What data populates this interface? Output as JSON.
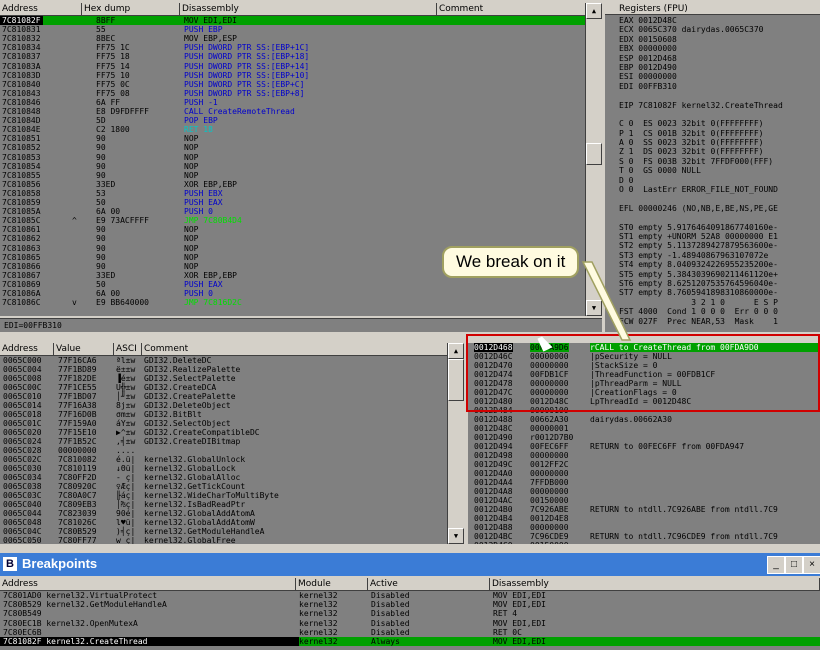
{
  "disasm": {
    "headers": [
      "Address",
      "Hex dump",
      "Disassembly",
      "Comment"
    ],
    "rows": [
      {
        "addr": "7C81082F",
        "mark": "",
        "hex": "8BFF",
        "dis": "MOV EDI,EDI",
        "cls": "",
        "sel": true
      },
      {
        "addr": "7C810831",
        "mark": "",
        "hex": "55",
        "dis": "PUSH EBP",
        "cls": "blue"
      },
      {
        "addr": "7C810832",
        "mark": "",
        "hex": "8BEC",
        "dis": "MOV EBP,ESP",
        "cls": ""
      },
      {
        "addr": "7C810834",
        "mark": "",
        "hex": "FF75 1C",
        "dis": "PUSH DWORD PTR SS:[EBP+1C]",
        "cls": "blue"
      },
      {
        "addr": "7C810837",
        "mark": "",
        "hex": "FF75 18",
        "dis": "PUSH DWORD PTR SS:[EBP+18]",
        "cls": "blue"
      },
      {
        "addr": "7C81083A",
        "mark": "",
        "hex": "FF75 14",
        "dis": "PUSH DWORD PTR SS:[EBP+14]",
        "cls": "blue"
      },
      {
        "addr": "7C81083D",
        "mark": "",
        "hex": "FF75 10",
        "dis": "PUSH DWORD PTR SS:[EBP+10]",
        "cls": "blue"
      },
      {
        "addr": "7C810840",
        "mark": "",
        "hex": "FF75 0C",
        "dis": "PUSH DWORD PTR SS:[EBP+C]",
        "cls": "blue"
      },
      {
        "addr": "7C810843",
        "mark": "",
        "hex": "FF75 08",
        "dis": "PUSH DWORD PTR SS:[EBP+8]",
        "cls": "blue"
      },
      {
        "addr": "7C810846",
        "mark": "",
        "hex": "6A FF",
        "dis": "PUSH -1",
        "cls": "blue"
      },
      {
        "addr": "7C810848",
        "mark": "",
        "hex": "E8 D9FDFFFF",
        "dis": "CALL CreateRemoteThread",
        "cls": "blue"
      },
      {
        "addr": "7C81084D",
        "mark": "",
        "hex": "5D",
        "dis": "POP EBP",
        "cls": "blue"
      },
      {
        "addr": "7C81084E",
        "mark": "",
        "hex": "C2 1800",
        "dis": "RET 18",
        "cls": "cyan"
      },
      {
        "addr": "7C810851",
        "mark": "",
        "hex": "90",
        "dis": "NOP",
        "cls": ""
      },
      {
        "addr": "7C810852",
        "mark": "",
        "hex": "90",
        "dis": "NOP",
        "cls": ""
      },
      {
        "addr": "7C810853",
        "mark": "",
        "hex": "90",
        "dis": "NOP",
        "cls": ""
      },
      {
        "addr": "7C810854",
        "mark": "",
        "hex": "90",
        "dis": "NOP",
        "cls": ""
      },
      {
        "addr": "7C810855",
        "mark": "",
        "hex": "90",
        "dis": "NOP",
        "cls": ""
      },
      {
        "addr": "7C810856",
        "mark": "",
        "hex": "33ED",
        "dis": "XOR EBP,EBP",
        "cls": ""
      },
      {
        "addr": "7C810858",
        "mark": "",
        "hex": "53",
        "dis": "PUSH EBX",
        "cls": "blue"
      },
      {
        "addr": "7C810859",
        "mark": "",
        "hex": "50",
        "dis": "PUSH EAX",
        "cls": "blue"
      },
      {
        "addr": "7C81085A",
        "mark": "",
        "hex": "6A 00",
        "dis": "PUSH 0",
        "cls": "blue"
      },
      {
        "addr": "7C81085C",
        "mark": "^",
        "hex": "E9 73ACFFFF",
        "dis": "JMP 7C80B4D4",
        "cls": "grn"
      },
      {
        "addr": "7C810861",
        "mark": "",
        "hex": "90",
        "dis": "NOP",
        "cls": ""
      },
      {
        "addr": "7C810862",
        "mark": "",
        "hex": "90",
        "dis": "NOP",
        "cls": ""
      },
      {
        "addr": "7C810863",
        "mark": "",
        "hex": "90",
        "dis": "NOP",
        "cls": ""
      },
      {
        "addr": "7C810865",
        "mark": "",
        "hex": "90",
        "dis": "NOP",
        "cls": ""
      },
      {
        "addr": "7C810866",
        "mark": "",
        "hex": "90",
        "dis": "NOP",
        "cls": ""
      },
      {
        "addr": "7C810867",
        "mark": "",
        "hex": "33ED",
        "dis": "XOR EBP,EBP",
        "cls": ""
      },
      {
        "addr": "7C810869",
        "mark": "",
        "hex": "50",
        "dis": "PUSH EAX",
        "cls": "blue"
      },
      {
        "addr": "7C81086A",
        "mark": "",
        "hex": "6A 00",
        "dis": "PUSH 0",
        "cls": "blue"
      },
      {
        "addr": "7C81086C",
        "mark": "v",
        "hex": "E9 BB640000",
        "dis": "JMP 7C816D2C",
        "cls": "grn"
      }
    ],
    "info": "EDI=00FFB310"
  },
  "registers": {
    "title": "Registers (FPU)",
    "lines": [
      "EAX 0012D48C",
      "ECX 0065C370 dairydas.0065C370",
      "EDX 00150608",
      "EBX 00000000",
      "ESP 0012D468",
      "EBP 0012D490",
      "ESI 00000000",
      "EDI 00FFB310",
      "",
      "EIP 7C81082F kernel32.CreateThread",
      "",
      "C 0  ES 0023 32bit 0(FFFFFFFF)",
      "P 1  CS 001B 32bit 0(FFFFFFFF)",
      "A 0  SS 0023 32bit 0(FFFFFFFF)",
      "Z 1  DS 0023 32bit 0(FFFFFFFF)",
      "S 0  FS 003B 32bit 7FFDF000(FFF)",
      "T 0  GS 0000 NULL",
      "D 0",
      "O 0  LastErr ERROR_FILE_NOT_FOUND",
      "",
      "EFL 00000246 (NO,NB,E,BE,NS,PE,GE",
      "",
      "ST0 empty 5.9176464091867740160e-",
      "ST1 empty +UNORM 52A8 00000000 E1",
      "ST2 empty 5.1137289427879563600e-",
      "ST3 empty -1.48940867963107072e",
      "ST4 empty 8.0409324226955235200e-",
      "ST5 empty 5.3843039690211461120e+",
      "ST6 empty 8.6251207535764596040e-",
      "ST7 empty 8.7605941898310860000e-",
      "               3 2 1 0      E S P",
      "FST 4000  Cond 1 0 0 0  Err 0 0 0",
      "FCW 027F  Prec NEAR,53  Mask    1"
    ]
  },
  "dump": {
    "headers": [
      "Address",
      "Value",
      "ASCI",
      "Comment"
    ],
    "rows": [
      {
        "addr": "0065C000",
        "val": "77F16CA6",
        "asc": "ªl±w",
        "cmt": "GDI32.DeleteDC"
      },
      {
        "addr": "0065C004",
        "val": "77F1BD89",
        "asc": "ë±±w",
        "cmt": "GDI32.RealizePalette"
      },
      {
        "addr": "0065C008",
        "val": "77F182DE",
        "asc": "▐é±w",
        "cmt": "GDI32.SelectPalette"
      },
      {
        "addr": "0065C00C",
        "val": "77F1CE55",
        "asc": "U╬±w",
        "cmt": "GDI32.CreateDCA"
      },
      {
        "addr": "0065C010",
        "val": "77F1BD07",
        "asc": "│╜±w",
        "cmt": "GDI32.CreatePalette"
      },
      {
        "addr": "0065C014",
        "val": "77F16A38",
        "asc": "8j±w",
        "cmt": "GDI32.DeleteObject"
      },
      {
        "addr": "0065C018",
        "val": "77F16D0B",
        "asc": "σm±w",
        "cmt": "GDI32.BitBlt"
      },
      {
        "addr": "0065C01C",
        "val": "77F159A0",
        "asc": "áY±w",
        "cmt": "GDI32.SelectObject"
      },
      {
        "addr": "0065C020",
        "val": "77F15E10",
        "asc": "▶^±w",
        "cmt": "GDI32.CreateCompatibleDC"
      },
      {
        "addr": "0065C024",
        "val": "77F1B52C",
        "asc": ",╡±w",
        "cmt": "GDI32.CreateDIBitmap"
      },
      {
        "addr": "0065C028",
        "val": "00000000",
        "asc": "....",
        "cmt": ""
      },
      {
        "addr": "0065C02C",
        "val": "7C810082",
        "asc": "é.ü|",
        "cmt": "kernel32.GlobalUnlock"
      },
      {
        "addr": "0065C030",
        "val": "7C810119",
        "asc": "↓Θü|",
        "cmt": "kernel32.GlobalLock"
      },
      {
        "addr": "0065C034",
        "val": "7C80FF2D",
        "asc": "- ç|",
        "cmt": "kernel32.GlobalAlloc"
      },
      {
        "addr": "0065C038",
        "val": "7C80920C",
        "asc": "♀Æç|",
        "cmt": "kernel32.GetTickCount"
      },
      {
        "addr": "0065C03C",
        "val": "7C80A0C7",
        "asc": "╟áç|",
        "cmt": "kernel32.WideCharToMultiByte"
      },
      {
        "addr": "0065C040",
        "val": "7C809EB3",
        "asc": "│₧ç|",
        "cmt": "kernel32.IsBadReadPtr"
      },
      {
        "addr": "0065C044",
        "val": "7C823039",
        "asc": "90é|",
        "cmt": "kernel32.GlobalAddAtomA"
      },
      {
        "addr": "0065C048",
        "val": "7C81026C",
        "asc": "l♥ü|",
        "cmt": "kernel32.GlobalAddAtomW"
      },
      {
        "addr": "0065C04C",
        "val": "7C80B529",
        "asc": ")╡ç|",
        "cmt": "kernel32.GetModuleHandleA"
      },
      {
        "addr": "0065C050",
        "val": "7C80FF77",
        "asc": "w ç|",
        "cmt": "kernel32.GlobalFree"
      }
    ]
  },
  "stack": {
    "rows": [
      {
        "addr": "0012D468",
        "val": "00FDA9D6",
        "txt": "rCALL to CreateThread from 00FDA9D0",
        "sel": true
      },
      {
        "addr": "0012D46C",
        "val": "00000000",
        "txt": "|pSecurity = NULL"
      },
      {
        "addr": "0012D470",
        "val": "00000000",
        "txt": "|StackSize = 0"
      },
      {
        "addr": "0012D474",
        "val": "00FDB1CF",
        "txt": "|ThreadFunction = 00FDB1CF"
      },
      {
        "addr": "0012D478",
        "val": "00000000",
        "txt": "|pThreadParm = NULL"
      },
      {
        "addr": "0012D47C",
        "val": "00000000",
        "txt": "|CreationFlags = 0"
      },
      {
        "addr": "0012D480",
        "val": "0012D48C",
        "txt": "LpThreadId = 0012D48C"
      },
      {
        "addr": "0012D484",
        "val": "00000100",
        "txt": ""
      },
      {
        "addr": "0012D488",
        "val": "00662A30",
        "txt": "dairydas.00662A30"
      },
      {
        "addr": "0012D48C",
        "val": "00000001",
        "txt": ""
      },
      {
        "addr": "0012D490",
        "val": "r0012D7B0",
        "txt": ""
      },
      {
        "addr": "0012D494",
        "val": "00FEC6FF",
        "txt": "RETURN to 00FEC6FF from 00FDA947"
      },
      {
        "addr": "0012D498",
        "val": "00000000",
        "txt": ""
      },
      {
        "addr": "0012D49C",
        "val": "0012FF2C",
        "txt": ""
      },
      {
        "addr": "0012D4A0",
        "val": "00000000",
        "txt": ""
      },
      {
        "addr": "0012D4A4",
        "val": "7FFDB000",
        "txt": ""
      },
      {
        "addr": "0012D4A8",
        "val": "00000000",
        "txt": ""
      },
      {
        "addr": "0012D4AC",
        "val": "00150000",
        "txt": ""
      },
      {
        "addr": "0012D4B0",
        "val": "7C926ABE",
        "txt": "RETURN to ntdll.7C926ABE from ntdll.7C9"
      },
      {
        "addr": "0012D4B4",
        "val": "0012D4E8",
        "txt": ""
      },
      {
        "addr": "0012D4B8",
        "val": "00000000",
        "txt": ""
      },
      {
        "addr": "0012D4BC",
        "val": "7C96CDE9",
        "txt": "RETURN to ntdll.7C96CDE9 from ntdll.7C9"
      },
      {
        "addr": "0012D4C0",
        "val": "00150000",
        "txt": ""
      }
    ]
  },
  "callout": "We break on it",
  "breakpoints": {
    "title": "Breakpoints",
    "headers": [
      "Address",
      "Module",
      "Active",
      "Disassembly"
    ],
    "rows": [
      {
        "addr": "7C801AD0 kernel32.VirtualProtect",
        "mod": "kernel32",
        "act": "Disabled",
        "dis": "MOV EDI,EDI"
      },
      {
        "addr": "7C80B529 kernel32.GetModuleHandleA",
        "mod": "kernel32",
        "act": "Disabled",
        "dis": "MOV EDI,EDI"
      },
      {
        "addr": "7C80B549",
        "mod": "kernel32",
        "act": "Disabled",
        "dis": "RET 4"
      },
      {
        "addr": "7C80EC1B kernel32.OpenMutexA",
        "mod": "kernel32",
        "act": "Disabled",
        "dis": "MOV EDI,EDI"
      },
      {
        "addr": "7C80EC6B",
        "mod": "kernel32",
        "act": "Disabled",
        "dis": "RET 0C"
      },
      {
        "addr": "7C81082F kernel32.CreateThread",
        "mod": "kernel32",
        "act": "Always",
        "dis": "MOV EDI,EDI",
        "sel": true
      }
    ]
  }
}
